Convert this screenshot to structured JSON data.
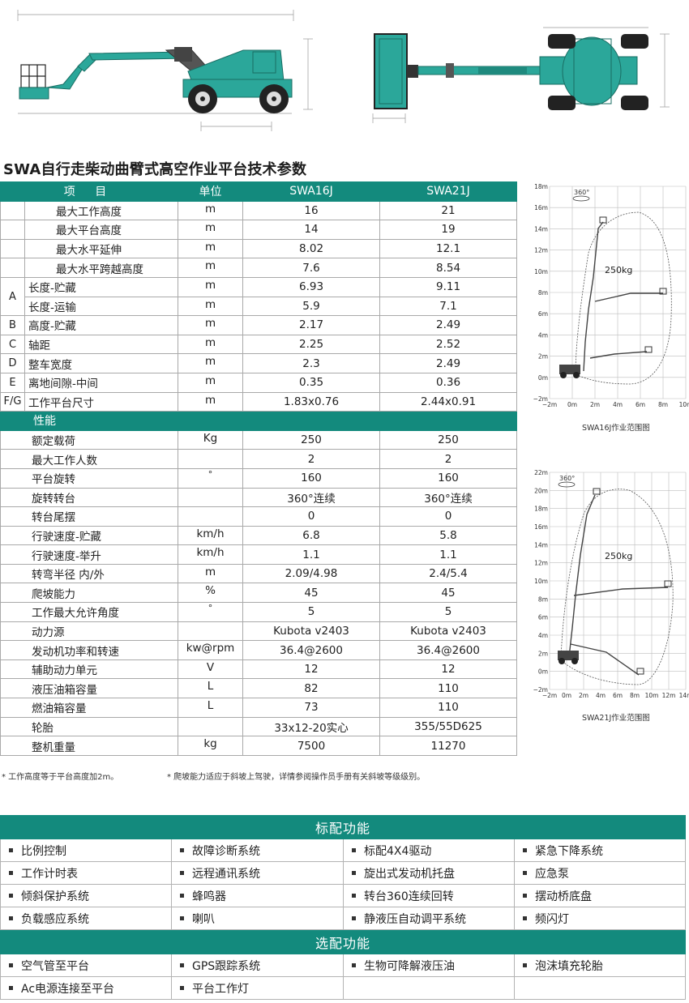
{
  "title": "SWA自行走柴动曲臂式高空作业平台技术参数",
  "table": {
    "header": {
      "item": "项 目",
      "unit": "单位",
      "model1": "SWA16J",
      "model2": "SWA21J"
    },
    "rows": [
      {
        "group": "",
        "name": "最大工作高度",
        "unit": "m",
        "v1": "16",
        "v2": "21"
      },
      {
        "group": "",
        "name": "最大平台高度",
        "unit": "m",
        "v1": "14",
        "v2": "19"
      },
      {
        "group": "",
        "name": "最大水平延伸",
        "unit": "m",
        "v1": "8.02",
        "v2": "12.1"
      },
      {
        "group": "",
        "name": "最大水平跨越高度",
        "unit": "m",
        "v1": "7.6",
        "v2": "8.54"
      },
      {
        "group": "A",
        "name": "长度-贮藏",
        "unit": "m",
        "v1": "6.93",
        "v2": "9.11"
      },
      {
        "group": "",
        "name": "长度-运输",
        "unit": "m",
        "v1": "5.9",
        "v2": "7.1"
      },
      {
        "group": "B",
        "name": "高度-贮藏",
        "unit": "m",
        "v1": "2.17",
        "v2": "2.49"
      },
      {
        "group": "C",
        "name": "轴距",
        "unit": "m",
        "v1": "2.25",
        "v2": "2.52"
      },
      {
        "group": "D",
        "name": "整车宽度",
        "unit": "m",
        "v1": "2.3",
        "v2": "2.49"
      },
      {
        "group": "E",
        "name": "离地间隙-中间",
        "unit": "m",
        "v1": "0.35",
        "v2": "0.36"
      },
      {
        "group": "F/G",
        "name": "工作平台尺寸",
        "unit": "m",
        "v1": "1.83x0.76",
        "v2": "2.44x0.91"
      }
    ],
    "section": "性能",
    "rows2": [
      {
        "name": "额定载荷",
        "unit": "Kg",
        "v1": "250",
        "v2": "250"
      },
      {
        "name": "最大工作人数",
        "unit": "",
        "v1": "2",
        "v2": "2"
      },
      {
        "name": "平台旋转",
        "unit": "°",
        "v1": "160",
        "v2": "160"
      },
      {
        "name": "旋转转台",
        "unit": "",
        "v1": "360°连续",
        "v2": "360°连续"
      },
      {
        "name": "转台尾摆",
        "unit": "",
        "v1": "0",
        "v2": "0"
      },
      {
        "name": "行驶速度-贮藏",
        "unit": "km/h",
        "v1": "6.8",
        "v2": "5.8"
      },
      {
        "name": "行驶速度-举升",
        "unit": "km/h",
        "v1": "1.1",
        "v2": "1.1"
      },
      {
        "name": "转弯半径 内/外",
        "unit": "m",
        "v1": "2.09/4.98",
        "v2": "2.4/5.4"
      },
      {
        "name": "爬坡能力",
        "unit": "%",
        "v1": "45",
        "v2": "45"
      },
      {
        "name": "工作最大允许角度",
        "unit": "°",
        "v1": "5",
        "v2": "5"
      },
      {
        "name": "动力源",
        "unit": "",
        "v1": "Kubota v2403",
        "v2": "Kubota v2403"
      },
      {
        "name": "发动机功率和转速",
        "unit": "kw@rpm",
        "v1": "36.4@2600",
        "v2": "36.4@2600"
      },
      {
        "name": "辅助动力单元",
        "unit": "V",
        "v1": "12",
        "v2": "12"
      },
      {
        "name": "液压油箱容量",
        "unit": "L",
        "v1": "82",
        "v2": "110"
      },
      {
        "name": "燃油箱容量",
        "unit": "L",
        "v1": "73",
        "v2": "110"
      },
      {
        "name": "轮胎",
        "unit": "",
        "v1": "33x12-20实心",
        "v2": "355/55D625"
      },
      {
        "name": "整机重量",
        "unit": "kg",
        "v1": "7500",
        "v2": "11270"
      }
    ]
  },
  "notes": {
    "n1": "* 工作高度等于平台高度加2m。",
    "n2": "* 爬坡能力适应于斜坡上驾驶，详情参阅操作员手册有关斜坡等级级别。"
  },
  "charts": {
    "c16": {
      "caption": "SWA16J作业范围图",
      "rotation": "360°",
      "load": "250kg",
      "yticks": [
        "18m",
        "16m",
        "14m",
        "12m",
        "10m",
        "8m",
        "6m",
        "4m",
        "2m",
        "0m",
        "−2m"
      ],
      "xticks": [
        "−2m",
        "0m",
        "2m",
        "4m",
        "6m",
        "8m",
        "10m"
      ]
    },
    "c21": {
      "caption": "SWA21J作业范围图",
      "rotation": "360°",
      "load": "250kg",
      "yticks": [
        "22m",
        "20m",
        "18m",
        "16m",
        "14m",
        "12m",
        "10m",
        "8m",
        "6m",
        "4m",
        "2m",
        "0m",
        "−2m"
      ],
      "xticks": [
        "−2m",
        "0m",
        "2m",
        "4m",
        "6m",
        "8m",
        "10m",
        "12m",
        "14m"
      ]
    }
  },
  "standard": {
    "title": "标配功能",
    "rows": [
      [
        "比例控制",
        "故障诊断系统",
        "标配4X4驱动",
        "紧急下降系统"
      ],
      [
        "工作计时表",
        "远程通讯系统",
        "旋出式发动机托盘",
        "应急泵"
      ],
      [
        "倾斜保护系统",
        "蜂鸣器",
        "转台360连续回转",
        "摆动桥底盘"
      ],
      [
        "负载感应系统",
        "喇叭",
        "静液压自动调平系统",
        "频闪灯"
      ]
    ]
  },
  "optional": {
    "title": "选配功能",
    "rows": [
      [
        "空气管至平台",
        "GPS跟踪系统",
        "生物可降解液压油",
        "泡沫填充轮胎"
      ],
      [
        "Ac电源连接至平台",
        "平台工作灯",
        "",
        ""
      ]
    ]
  },
  "colors": {
    "accent": "#138a7d",
    "machine": "#2ba79a"
  }
}
